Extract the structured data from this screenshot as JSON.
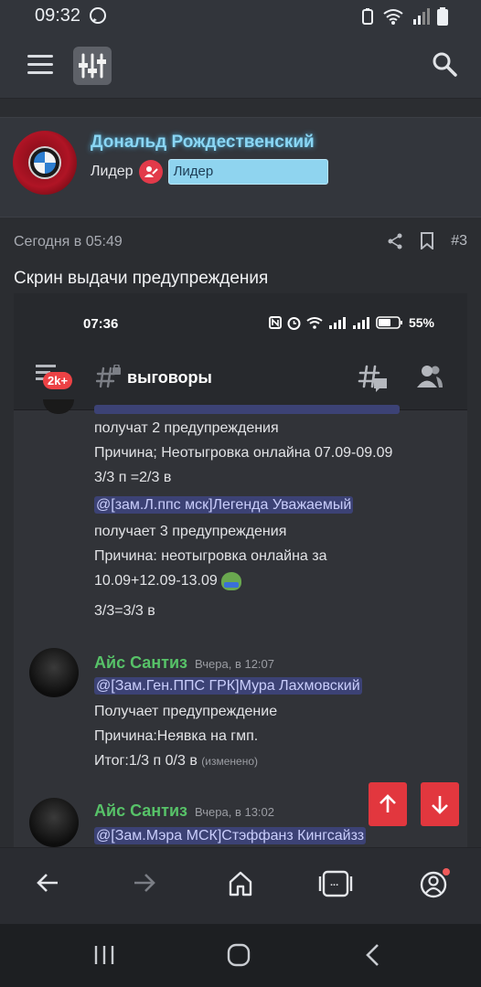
{
  "status_bar": {
    "time": "09:32",
    "icons": [
      "viber-icon",
      "recycle-icon",
      "wifi-icon",
      "signal-icon",
      "battery-icon"
    ]
  },
  "app_bar": {
    "icons": [
      "menu-icon",
      "site-logo-icon",
      "search-icon"
    ]
  },
  "post": {
    "author": "Дональд Рождественский",
    "role_text": "Лидер",
    "role_badge": "Лидер",
    "timestamp": "Сегодня в 05:49",
    "post_number": "#3",
    "title": "Скрин выдачи предупреждения"
  },
  "screenshot": {
    "status_time": "07:36",
    "battery": "55%",
    "badge": "2k+",
    "channel": "выговоры",
    "lines_top": [
      "получат 2 предупреждения",
      "Причина; Неотыгровка онлайна 07.09-09.09",
      "3/3 п =2/3 в"
    ],
    "block2": {
      "mention": "@[зам.Л.ппс мск]Легенда Уважаемый",
      "lines": [
        "получает 3 предупреждения",
        "Причина: неотыгровка онлайна за",
        "10.09+12.09-13.09",
        "3/3=3/3 в"
      ]
    },
    "msg1": {
      "user": "Айс Сантиз",
      "time": "Вчера, в 12:07",
      "mention": "@[Зам.Ген.ППС ГРК]Мура Лахмовский",
      "lines": [
        "Получает предупреждение",
        "Причина:Неявка на гмп."
      ],
      "result": "Итог:1/3 п 0/3 в",
      "edited": "(изменено)"
    },
    "msg2": {
      "user": "Айс Сантиз",
      "time": "Вчера, в 13:02",
      "mention": "@[Зам.Мэра МСК]Стэффанз Кингсайзз"
    }
  },
  "browser_bar": {
    "tabs_count": "...",
    "icons": [
      "back-arrow-icon",
      "forward-arrow-icon",
      "home-icon",
      "tabs-icon",
      "profile-icon"
    ]
  },
  "colors": {
    "accent_red": "#e2373e",
    "author_name": "#8ad6f4",
    "discord_green": "#57c268",
    "mention_bg": "#3c4275"
  }
}
